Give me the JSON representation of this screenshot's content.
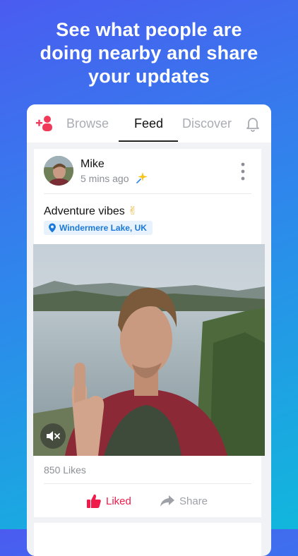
{
  "headline": {
    "line1": "See what people are",
    "line2": "doing nearby and share",
    "line3": "your updates"
  },
  "tabs": [
    {
      "label": "Browse",
      "active": false
    },
    {
      "label": "Feed",
      "active": true
    },
    {
      "label": "Discover",
      "active": false
    }
  ],
  "post": {
    "author": "Mike",
    "time": "5 mins ago",
    "caption": "Adventure vibes",
    "caption_emoji": "✌",
    "location": "Windermere Lake, UK",
    "likes": "850 Likes",
    "like_label": "Liked",
    "share_label": "Share"
  },
  "icons": [
    "add-user-icon",
    "bell-icon",
    "sparkle-icon",
    "more-icon",
    "location-pin-icon",
    "mute-icon",
    "thumbs-up-icon",
    "share-arrow-icon"
  ],
  "colors": {
    "accent_red": "#ee1b4b",
    "location_blue": "#1a79d8",
    "background_top": "#4a5cf0",
    "background_bottom": "#11b7dc"
  }
}
